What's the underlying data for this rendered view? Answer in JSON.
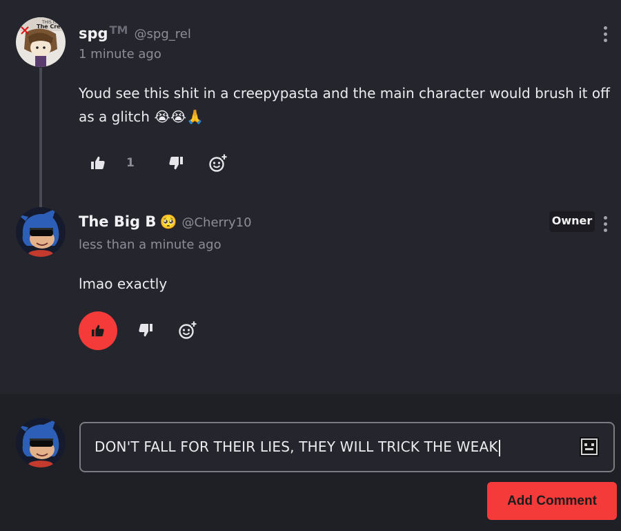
{
  "comments": [
    {
      "username": "spg",
      "username_suffix": "TM",
      "handle": "@spg_rel",
      "time": "1 minute ago",
      "text": "Youd see this shit in a creepypasta and the main character would brush it off as a glitch 😭😭🙏",
      "like_count": "1",
      "avatar_text": "The Creator"
    },
    {
      "username": "The Big B",
      "username_emoji": "🥺",
      "handle": "@Cherry10",
      "time": "less than a minute ago",
      "badge": "Owner",
      "text": "lmao exactly",
      "liked": true
    }
  ],
  "composer": {
    "input_value": "DON'T FALL FOR THEIR LIES, THEY WILL TRICK THE WEAK",
    "submit_label": "Add Comment"
  },
  "colors": {
    "background": "#25252e",
    "composer_background": "#1f1f26",
    "accent": "#f53a3a"
  },
  "icons": [
    "kebab-menu-icon",
    "thumbs-up-icon",
    "thumbs-down-icon",
    "add-reaction-icon",
    "emoji-picker-icon"
  ]
}
